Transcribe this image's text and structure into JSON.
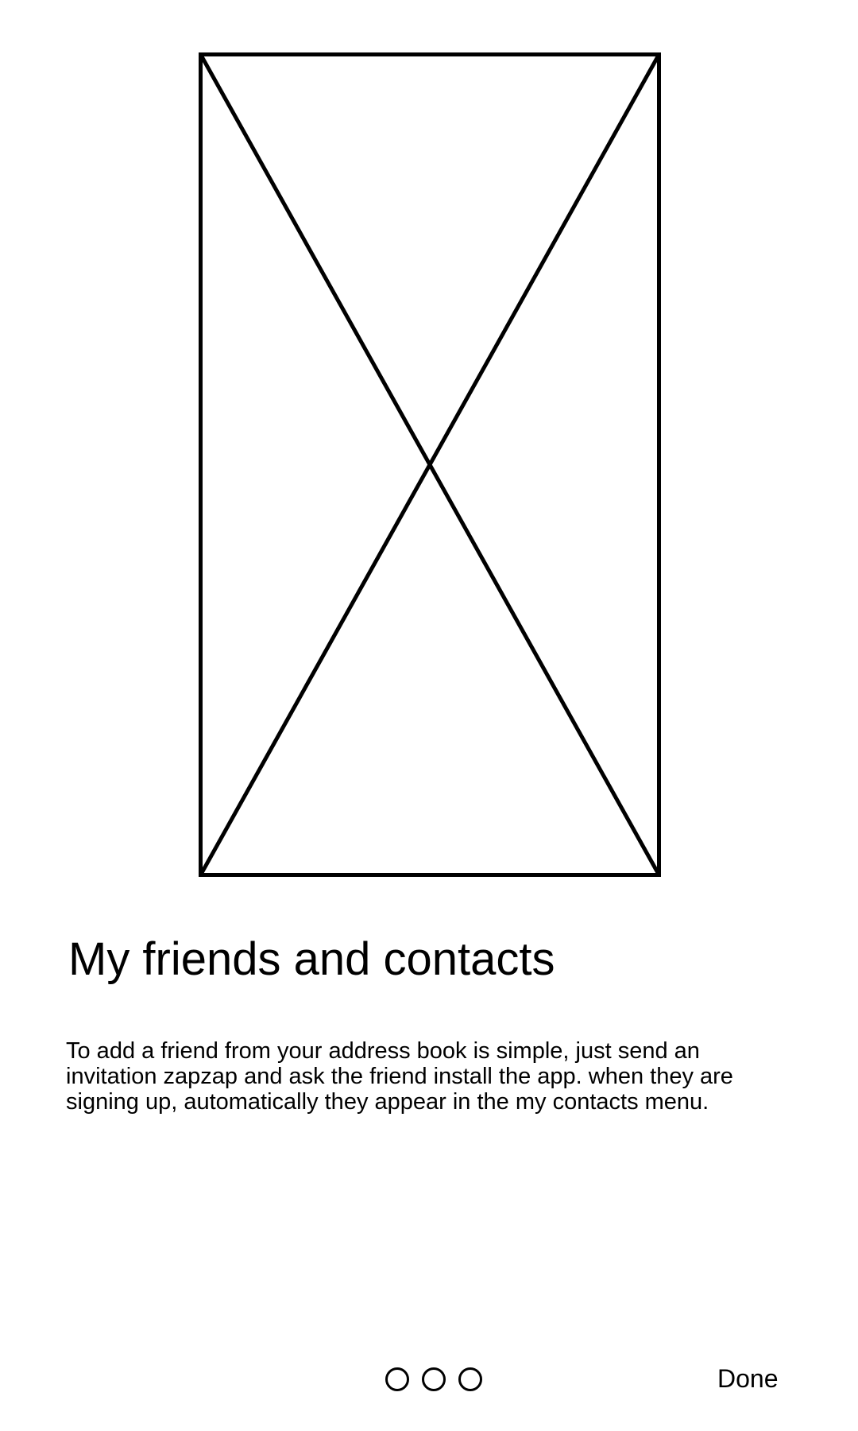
{
  "onboarding": {
    "image_placeholder_icon": "image-placeholder-icon",
    "title": "My friends and contacts",
    "description": "To add a friend from your address book is simple, just send an invitation zapzap and ask the friend install the app. when they are signing up, automatically they appear in the my contacts menu.",
    "page_count": 3,
    "done_label": "Done"
  }
}
